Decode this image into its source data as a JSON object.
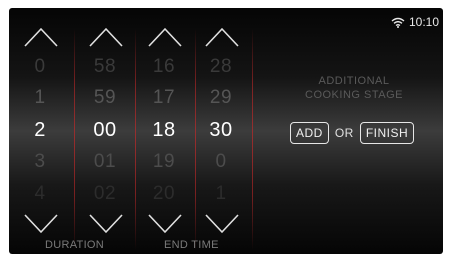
{
  "status": {
    "time": "10:10",
    "wifi_icon": "wifi-icon"
  },
  "pickers": [
    {
      "name": "duration-hours",
      "rows": [
        "0",
        "1",
        "2",
        "3",
        "4"
      ],
      "selected": "2"
    },
    {
      "name": "duration-minutes",
      "rows": [
        "58",
        "59",
        "00",
        "01",
        "02"
      ],
      "selected": "00"
    },
    {
      "name": "end-time-hours",
      "rows": [
        "16",
        "17",
        "18",
        "19",
        "20"
      ],
      "selected": "18"
    },
    {
      "name": "end-time-minutes",
      "rows": [
        "28",
        "29",
        "30",
        "0",
        "1"
      ],
      "selected": "30"
    }
  ],
  "captions": {
    "duration": "DURATION",
    "end_time": "END TIME"
  },
  "stage": {
    "label_line1": "ADDITIONAL",
    "label_line2": "COOKING STAGE",
    "add": "ADD",
    "or": "OR",
    "finish": "FINISH"
  },
  "colors": {
    "accent_divider": "#c82828",
    "background": "#0a0a0a",
    "text": "#ffffff"
  }
}
